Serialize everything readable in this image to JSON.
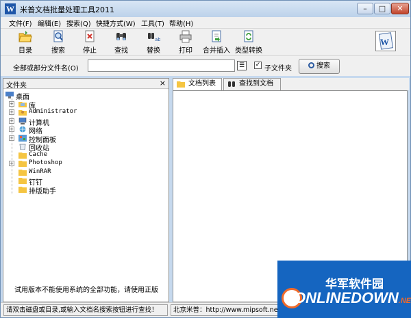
{
  "window": {
    "title": "米普文档批量处理工具2011"
  },
  "menu": [
    "文件(F)",
    "编辑(E)",
    "搜索(Q)",
    "快捷方式(W)",
    "工具(T)",
    "帮助(H)"
  ],
  "toolbar": {
    "directory": "目录",
    "search": "搜索",
    "stop": "停止",
    "find": "查找",
    "replace": "替换",
    "print": "打印",
    "merge_insert": "合并插入",
    "type_convert": "类型转换"
  },
  "search_row": {
    "label": "全部或部分文件名(O)",
    "input_value": "",
    "subfolder_label": "子文件夹",
    "subfolder_checked": "✓",
    "search_button": "搜索"
  },
  "folder_panel": {
    "title": "文件夹",
    "close": "×",
    "tree": [
      {
        "label": "桌面",
        "icon": "desktop-icon"
      },
      {
        "label": "库",
        "icon": "library-icon",
        "expandable": true
      },
      {
        "label": "Administrator",
        "icon": "user-icon",
        "expandable": true
      },
      {
        "label": "计算机",
        "icon": "computer-icon",
        "expandable": true
      },
      {
        "label": "网络",
        "icon": "network-icon",
        "expandable": true
      },
      {
        "label": "控制面板",
        "icon": "control-panel-icon",
        "expandable": true
      },
      {
        "label": "回收站",
        "icon": "recycle-bin-icon"
      },
      {
        "label": "Cache",
        "icon": "folder-icon"
      },
      {
        "label": "Photoshop",
        "icon": "folder-icon",
        "expandable": true
      },
      {
        "label": "WinRAR",
        "icon": "folder-icon"
      },
      {
        "label": "钉钉",
        "icon": "folder-icon"
      },
      {
        "label": "排版助手",
        "icon": "folder-icon"
      }
    ],
    "trial_note": "试用版本不能使用系统的全部功能，请使用正版"
  },
  "right_panel": {
    "tabs": [
      "文档列表",
      "查找到文档"
    ]
  },
  "status": {
    "left": "请双击磁盘或目录,或输入文档名搜索按钮进行查找！",
    "right": "北京米普：http://www.mipsoft.net"
  },
  "watermark": {
    "top": "华军软件园",
    "bottom": "ONLINEDOWN",
    "suffix": ".NET"
  },
  "colors": {
    "accent": "#1565c0",
    "title_bar": "#c6d9ee",
    "chrome": "#f0f0f0",
    "folder": "#f5c542"
  }
}
